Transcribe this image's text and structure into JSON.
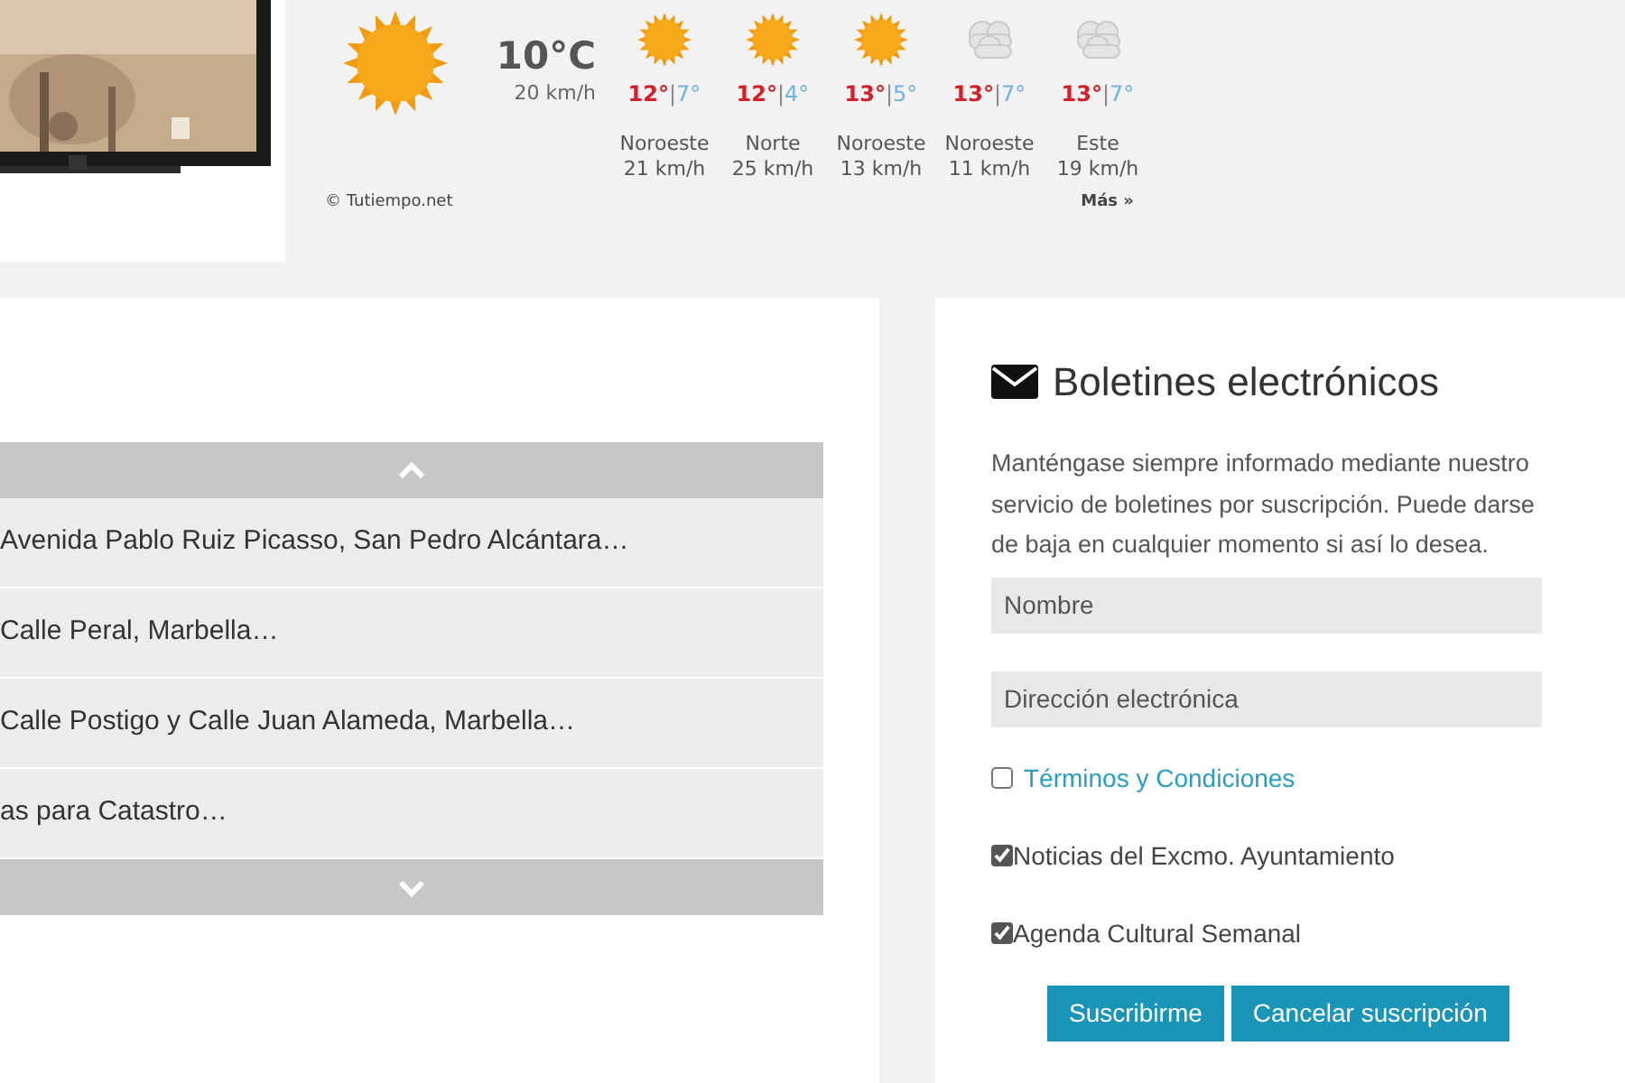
{
  "weather": {
    "current": {
      "kind": "sunny",
      "temperature": "10°C",
      "wind": "20 km/h"
    },
    "forecast": [
      {
        "kind": "sunny",
        "max": "12°",
        "sep": "|",
        "min": "7°",
        "direction": "Noroeste",
        "wind": "21 km/h"
      },
      {
        "kind": "sunny",
        "max": "12°",
        "sep": "|",
        "min": "4°",
        "direction": "Norte",
        "wind": "25 km/h"
      },
      {
        "kind": "sunny",
        "max": "13°",
        "sep": "|",
        "min": "5°",
        "direction": "Noroeste",
        "wind": "13 km/h"
      },
      {
        "kind": "cloudy",
        "max": "13°",
        "sep": "|",
        "min": "7°",
        "direction": "Noroeste",
        "wind": "11 km/h"
      },
      {
        "kind": "cloudy",
        "max": "13°",
        "sep": "|",
        "min": "7°",
        "direction": "Este",
        "wind": "19 km/h"
      }
    ],
    "credit": "© Tutiempo.net",
    "more": "Más »"
  },
  "list": {
    "items": [
      "Avenida Pablo Ruiz Picasso, San Pedro Alcántara…",
      "Calle Peral, Marbella…",
      "Calle Postigo y Calle Juan Alameda, Marbella…",
      "as para Catastro…"
    ]
  },
  "newsletter": {
    "title": "Boletines electrónicos",
    "text": "Manténgase siempre informado mediante nuestro servicio de boletines por suscripción. Puede darse de baja en cualquier momento si así lo desea.",
    "fields": [
      {
        "placeholder": "Nombre"
      },
      {
        "placeholder": "Dirección electrónica"
      }
    ],
    "options": [
      {
        "label": "Términos y Condiciones",
        "kind": "link",
        "checked": false
      },
      {
        "label": "Noticias del Excmo. Ayuntamiento",
        "kind": "text",
        "checked": true
      },
      {
        "label": "Agenda Cultural Semanal",
        "kind": "text",
        "checked": true
      }
    ],
    "buttons": [
      "Suscribirme",
      "Cancelar suscripción"
    ]
  }
}
